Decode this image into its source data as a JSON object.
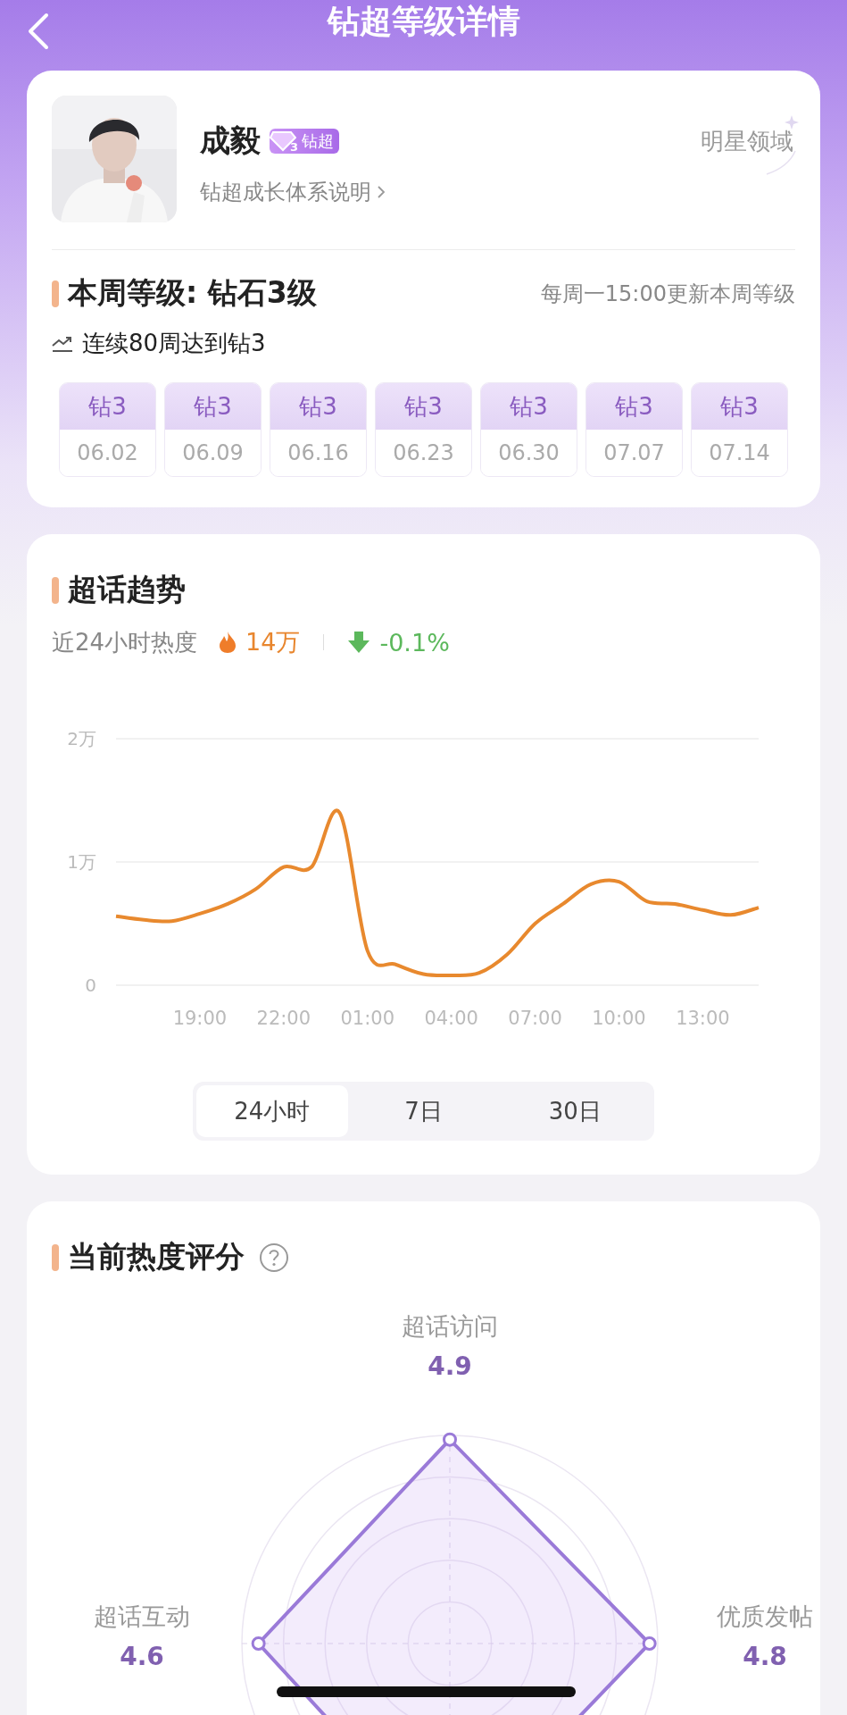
{
  "header": {
    "title": "钻超等级详情"
  },
  "profile": {
    "name": "成毅",
    "badge_level": "3",
    "badge": "钻超",
    "link": "钻超成长体系说明",
    "domain": "明星领域"
  },
  "level": {
    "title": "本周等级: 钻石3级",
    "update_note": "每周一15:00更新本周等级",
    "streak": "连续80周达到钻3",
    "weeks": [
      {
        "level": "钻3",
        "date": "06.02"
      },
      {
        "level": "钻3",
        "date": "06.09"
      },
      {
        "level": "钻3",
        "date": "06.16"
      },
      {
        "level": "钻3",
        "date": "06.23"
      },
      {
        "level": "钻3",
        "date": "06.30"
      },
      {
        "level": "钻3",
        "date": "07.07"
      },
      {
        "level": "钻3",
        "date": "07.14"
      }
    ]
  },
  "trend": {
    "title": "超话趋势",
    "heat_label": "近24小时热度",
    "heat_value": "14万",
    "change": "-0.1%",
    "chart_data": {
      "type": "line",
      "categories": [
        null,
        null,
        null,
        "19:00",
        null,
        null,
        "22:00",
        null,
        null,
        "01:00",
        null,
        null,
        "04:00",
        null,
        null,
        "07:00",
        null,
        null,
        "10:00",
        null,
        null,
        "13:00",
        null,
        null
      ],
      "series": [
        {
          "color": "#e8892e",
          "values": [
            0.56,
            0.53,
            0.52,
            0.58,
            0.66,
            0.78,
            0.96,
            0.96,
            1.4,
            0.28,
            0.17,
            0.09,
            0.08,
            0.1,
            0.25,
            0.5,
            0.66,
            0.82,
            0.84,
            0.68,
            0.66,
            0.61,
            0.57,
            0.63
          ]
        }
      ],
      "ylim": [
        0,
        2
      ],
      "yticks": [
        0,
        {
          "value": 1,
          "label": "1万"
        },
        {
          "value": 2,
          "label": "2万"
        }
      ]
    },
    "ranges": [
      {
        "label": "24小时",
        "selected": true
      },
      {
        "label": "7日",
        "selected": false
      },
      {
        "label": "30日",
        "selected": false
      }
    ]
  },
  "score": {
    "title": "当前热度评分",
    "axes": [
      {
        "label": "超话访问",
        "score": "4.9"
      },
      {
        "label": "超话互动",
        "score": "4.6"
      },
      {
        "label": "优质发帖",
        "score": "4.8"
      }
    ]
  }
}
